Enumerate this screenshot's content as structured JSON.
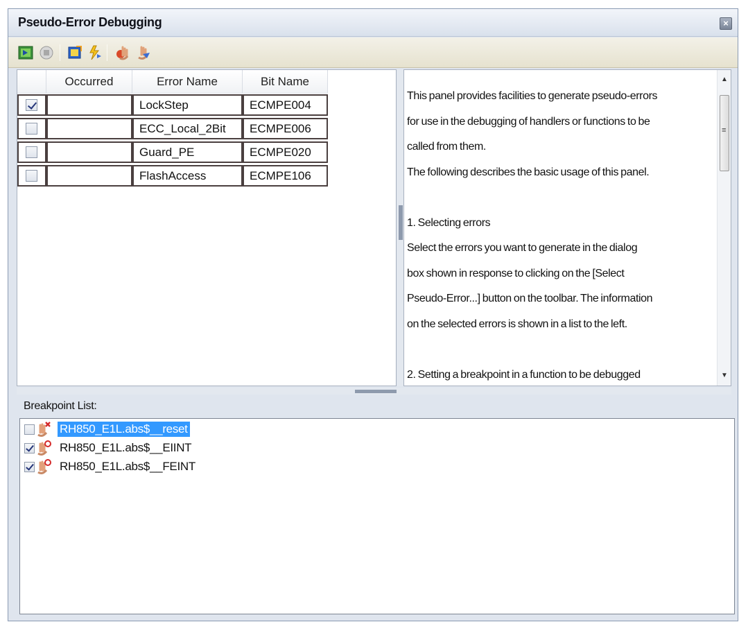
{
  "window": {
    "title": "Pseudo-Error Debugging",
    "close_icon": "close-icon"
  },
  "toolbar": {
    "buttons": [
      {
        "name": "start-icon"
      },
      {
        "name": "stop-icon"
      },
      {
        "name": "select-pseudo-error-icon"
      },
      {
        "name": "generate-error-icon"
      },
      {
        "name": "set-breakpoint-icon"
      },
      {
        "name": "remove-breakpoint-icon"
      }
    ]
  },
  "errors_table": {
    "columns": [
      "",
      "Occurred",
      "Error Name",
      "Bit Name"
    ],
    "rows": [
      {
        "checked": true,
        "occurred": "",
        "error_name": "LockStep",
        "bit_name": "ECMPE004"
      },
      {
        "checked": false,
        "occurred": "",
        "error_name": "ECC_Local_2Bit",
        "bit_name": "ECMPE006"
      },
      {
        "checked": false,
        "occurred": "",
        "error_name": "Guard_PE",
        "bit_name": "ECMPE020"
      },
      {
        "checked": false,
        "occurred": "",
        "error_name": "FlashAccess",
        "bit_name": "ECMPE106"
      }
    ]
  },
  "info": {
    "lines": [
      "This panel provides facilities to generate pseudo-errors",
      "for use in the debugging of handlers or functions to be",
      "called from them.",
      "The following describes the basic usage of this panel.",
      "",
      "1. Selecting errors",
      "Select the errors you want to generate in the dialog",
      "box shown in response to clicking on the [Select",
      "Pseudo-Error...] button on the toolbar. The information",
      "on the selected errors is shown in a list to the left.",
      "",
      "2. Setting a breakpoint in a function to be debugged"
    ]
  },
  "breakpoints": {
    "label": "Breakpoint List:",
    "items": [
      {
        "checked": false,
        "text": "RH850_E1L.abs$__reset",
        "selected": true,
        "icon": "breakpoint-disabled-icon"
      },
      {
        "checked": true,
        "text": "RH850_E1L.abs$__EIINT",
        "selected": false,
        "icon": "breakpoint-enabled-icon"
      },
      {
        "checked": true,
        "text": "RH850_E1L.abs$__FEINT",
        "selected": false,
        "icon": "breakpoint-enabled-icon"
      }
    ]
  }
}
